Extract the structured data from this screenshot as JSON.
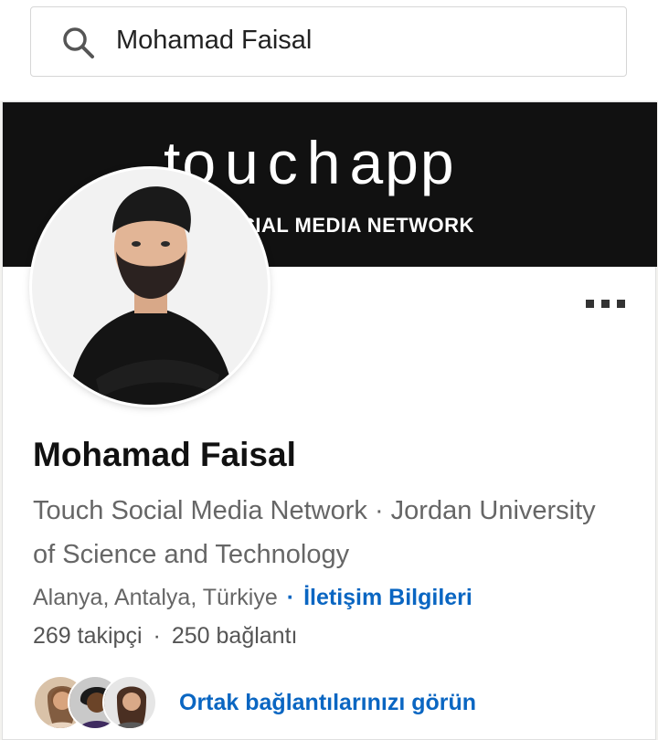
{
  "search": {
    "value": "Mohamad Faisal"
  },
  "cover": {
    "logo_prefix": "t",
    "logo_mid": "ouch",
    "logo_suffix": "app",
    "tagline": "CIAL MEDIA NETWORK"
  },
  "profile": {
    "name": "Mohamad Faisal",
    "headline": "Touch Social Media Network · Jordan University of Science and Technology",
    "location": "Alanya, Antalya, Türkiye",
    "location_separator": "·",
    "contact_label": "İletişim Bilgileri",
    "followers": "269 takipçi",
    "stats_separator": "·",
    "connections": "250 bağlantı",
    "mutual_label": "Ortak bağlantılarınızı görün"
  },
  "icons": {
    "search": "search-icon",
    "more": "more-options-icon"
  },
  "colors": {
    "accent": "#0a66c2",
    "cover_bg": "#111111",
    "text_primary": "#111111",
    "text_secondary": "#666666"
  }
}
